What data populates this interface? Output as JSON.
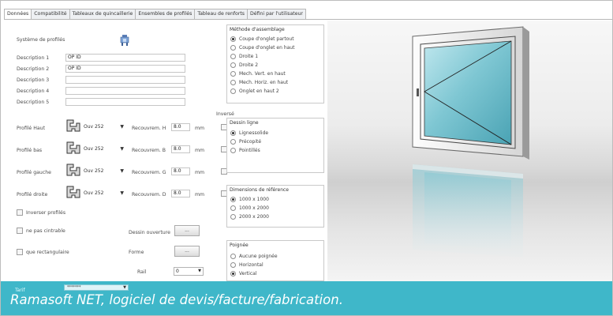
{
  "tabs": [
    {
      "label": "Données"
    },
    {
      "label": "Compatibilité"
    },
    {
      "label": "Tableaux de quincaillerie"
    },
    {
      "label": "Ensembles de profilés"
    },
    {
      "label": "Tableau de renforts"
    },
    {
      "label": "Défini par l'utilisateur"
    }
  ],
  "system": {
    "label": "Système de profilés",
    "icon": "profile-system-icon"
  },
  "descriptions": [
    {
      "label": "Description 1",
      "value": "OP ID"
    },
    {
      "label": "Description 2",
      "value": "OP ID"
    },
    {
      "label": "Description 3",
      "value": ""
    },
    {
      "label": "Description 4",
      "value": ""
    },
    {
      "label": "Description 5",
      "value": ""
    }
  ],
  "inverse_label": "Inversé",
  "unit": "mm",
  "profiles": [
    {
      "label": "Profilé Haut",
      "value": "Ouv 252",
      "recouv_label": "Recouvrem. H",
      "recouv_value": "8.0"
    },
    {
      "label": "Profilé bas",
      "value": "Ouv 252",
      "recouv_label": "Recouvrem. B",
      "recouv_value": "8.0"
    },
    {
      "label": "Profilé gauche",
      "value": "Ouv 252",
      "recouv_label": "Recouvrem. G",
      "recouv_value": "8.0"
    },
    {
      "label": "Profilé droite",
      "value": "Ouv 252",
      "recouv_label": "Recouvrem. D",
      "recouv_value": "8.0"
    }
  ],
  "options": {
    "inverser": "Inverser profilés",
    "cintrable": "ne pas cintrable",
    "rectangulaire": "que rectangulaire"
  },
  "dessin_ouverture": {
    "label": "Dessin ouverture",
    "button": "..."
  },
  "forme": {
    "label": "Forme",
    "button": "..."
  },
  "rail": {
    "label": "Rail",
    "value": "0"
  },
  "groups": {
    "assemblage": {
      "title": "Méthode d'assemblage",
      "items": [
        "Coupe d'onglet partout",
        "Coupe d'onglet en haut",
        "Droite 1",
        "Droite 2",
        "Mech. Vert. en haut",
        "Mech. Horiz. en haut",
        "Onglet en haut 2"
      ],
      "selected": 0
    },
    "dessin_ligne": {
      "title": "Dessin ligne",
      "items": [
        "Lignessolide",
        "Précopité",
        "Pointillés"
      ],
      "selected": 0
    },
    "dimensions": {
      "title": "Dimensions de référence",
      "items": [
        "1000 x 1000",
        "1000 x 2000",
        "2000 x 2000"
      ],
      "selected": 0
    },
    "poignee": {
      "title": "Poignée",
      "items": [
        "Aucune poignée",
        "Horizontal",
        "Vertical"
      ],
      "selected": 2
    }
  },
  "tarif": {
    "label": "Tarif",
    "value": "*******"
  },
  "caption": "Ramasoft NET, logiciel de devis/facture/fabrication.",
  "colors": {
    "caption_bg": "#3fb7c9",
    "glass": "#7fc7d3"
  }
}
